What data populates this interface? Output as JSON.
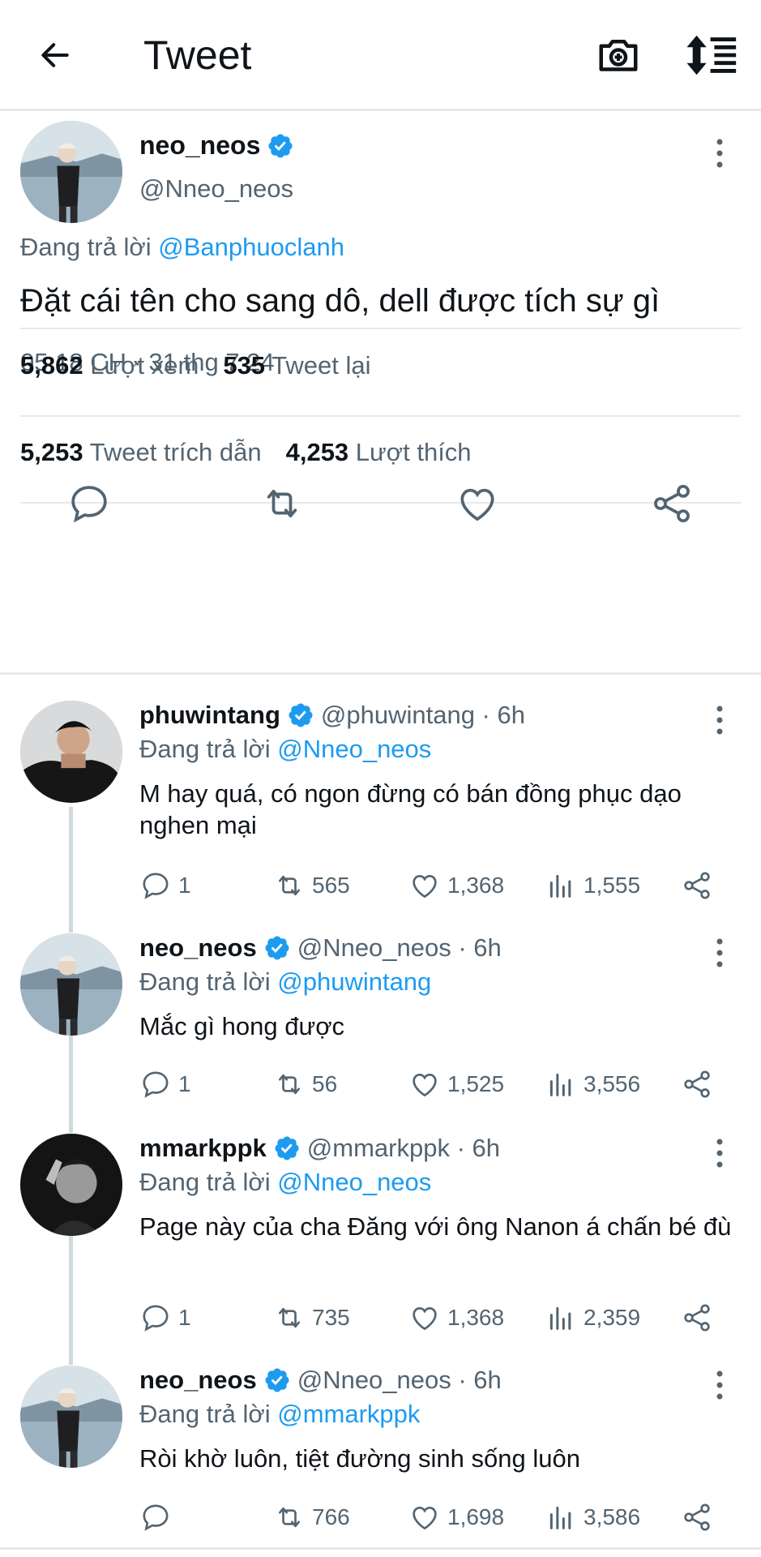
{
  "header": {
    "title": "Tweet"
  },
  "tweet": {
    "name": "neo_neos",
    "handle": "@Nneo_neos",
    "reply_prefix": "Đang trả lời",
    "reply_to": "@Banphuoclanh",
    "text": "Đặt cái tên cho sang dô, dell được tích sự gì",
    "time": "05:18 CH · 31 thg 7 24",
    "views_count": "5,862",
    "views_label": "Lượt xem",
    "retweets_count": "535",
    "retweets_label": "Tweet lại",
    "quotes_count": "5,253",
    "quotes_label": "Tweet trích dẫn",
    "likes_count": "4,253",
    "likes_label": "Lượt thích"
  },
  "replies": [
    {
      "name": "phuwintang",
      "handle": "@phuwintang · 6h",
      "reply_prefix": "Đang trả lời",
      "reply_to": "@Nneo_neos",
      "text": "M hay quá, có ngon đừng có bán đồng phục dạo nghen mại",
      "replies": "1",
      "retweets": "565",
      "likes": "1,368",
      "views": "1,555"
    },
    {
      "name": "neo_neos",
      "handle": "@Nneo_neos · 6h",
      "reply_prefix": "Đang trả lời",
      "reply_to": "@phuwintang",
      "text": "Mắc gì hong được",
      "replies": "1",
      "retweets": "56",
      "likes": "1,525",
      "views": "3,556"
    },
    {
      "name": "mmarkppk",
      "handle": "@mmarkppk · 6h",
      "reply_prefix": "Đang trả lời",
      "reply_to": "@Nneo_neos",
      "text": "Page này của cha Đăng với ông Nanon á chấn bé đù",
      "replies": "1",
      "retweets": "735",
      "likes": "1,368",
      "views": "2,359"
    },
    {
      "name": "neo_neos",
      "handle": "@Nneo_neos · 6h",
      "reply_prefix": "Đang trả lời",
      "reply_to": "@mmarkppk",
      "text": "Ròi khờ luôn, tiệt đường sinh sống luôn",
      "replies": "",
      "retweets": "766",
      "likes": "1,698",
      "views": "3,586"
    }
  ],
  "colors": {
    "accent": "#1d9bf0",
    "secondary_text": "#536471",
    "primary_text": "#0f1419",
    "divider": "#e6e9ec"
  }
}
